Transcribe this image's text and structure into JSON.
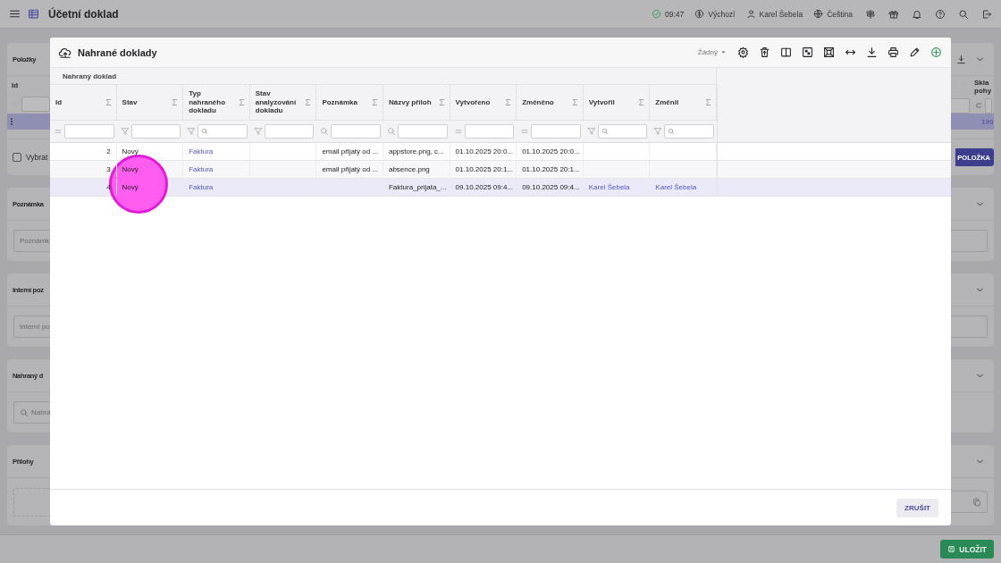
{
  "topbar": {
    "title": "Účetní doklad",
    "time": "09:47",
    "profile": "Výchozí",
    "user": "Karel Šebela",
    "language": "Čeština"
  },
  "background": {
    "items": {
      "title": "Položky",
      "column_1": "Id",
      "column_2": "Skla pohy",
      "row_value": "199",
      "select_label": "Vybrat",
      "select_checked": false,
      "add_button": "POLOŽKA"
    },
    "sections": [
      {
        "title": "Poznámka",
        "kind": "field",
        "placeholder": "Poznámk"
      },
      {
        "title": "Interní poz",
        "kind": "field",
        "placeholder": "Interní po"
      },
      {
        "title": "Nahraný d",
        "kind": "search",
        "placeholder": "Nahra"
      },
      {
        "title": "Přílohy",
        "kind": "upload"
      }
    ],
    "save_button": "ULOŽIT"
  },
  "dialog": {
    "title": "Nahrané doklady",
    "view": "Žádný",
    "group_header": "Nahraný doklad",
    "columns": [
      {
        "label": "Id",
        "kind": "equals",
        "search_icon": false
      },
      {
        "label": "Stav",
        "kind": "funnel",
        "search_icon": false
      },
      {
        "label": "Typ nahraného dokladu",
        "kind": "funnel",
        "search_icon": true
      },
      {
        "label": "Stav analyzování dokladu",
        "kind": "funnel",
        "search_icon": false
      },
      {
        "label": "Poznámka",
        "kind": "search",
        "search_icon": false
      },
      {
        "label": "Názvy příloh",
        "kind": "search",
        "search_icon": false
      },
      {
        "label": "Vytvořeno",
        "kind": "equals",
        "search_icon": false
      },
      {
        "label": "Změněno",
        "kind": "equals",
        "search_icon": false
      },
      {
        "label": "Vytvořil",
        "kind": "funnel",
        "search_icon": true
      },
      {
        "label": "Změnil",
        "kind": "funnel",
        "search_icon": true
      }
    ],
    "rows": [
      {
        "selected": false,
        "cells": [
          {
            "kind": "number",
            "text": "2"
          },
          {
            "kind": "text",
            "text": "Nový"
          },
          {
            "kind": "link",
            "text": "Faktura"
          },
          {
            "kind": "empty"
          },
          {
            "kind": "text",
            "text": "email přijatý od ..."
          },
          {
            "kind": "text",
            "text": "appstore.png, c..."
          },
          {
            "kind": "text",
            "text": "01.10.2025 20:0..."
          },
          {
            "kind": "text",
            "text": "01.10.2025 20:0..."
          },
          {
            "kind": "empty"
          },
          {
            "kind": "empty"
          }
        ]
      },
      {
        "selected": false,
        "cells": [
          {
            "kind": "number",
            "text": "3"
          },
          {
            "kind": "text",
            "text": "Nový"
          },
          {
            "kind": "link",
            "text": "Faktura"
          },
          {
            "kind": "empty"
          },
          {
            "kind": "text",
            "text": "email přijatý od ..."
          },
          {
            "kind": "text",
            "text": "absence.png"
          },
          {
            "kind": "text",
            "text": "01.10.2025 20:1..."
          },
          {
            "kind": "text",
            "text": "01.10.2025 20:1..."
          },
          {
            "kind": "empty"
          },
          {
            "kind": "empty"
          }
        ]
      },
      {
        "selected": true,
        "cells": [
          {
            "kind": "number",
            "text": "4"
          },
          {
            "kind": "text",
            "text": "Nový"
          },
          {
            "kind": "link",
            "text": "Faktura"
          },
          {
            "kind": "empty"
          },
          {
            "kind": "empty"
          },
          {
            "kind": "text",
            "text": "Faktura_prijata_..."
          },
          {
            "kind": "text",
            "text": "09.10.2025 09:4..."
          },
          {
            "kind": "text",
            "text": "09.10.2025 09:4..."
          },
          {
            "kind": "link",
            "text": "Karel Šebela"
          },
          {
            "kind": "link",
            "text": "Karel Šebela"
          }
        ]
      }
    ],
    "cancel_button": "ZRUŠIT"
  }
}
